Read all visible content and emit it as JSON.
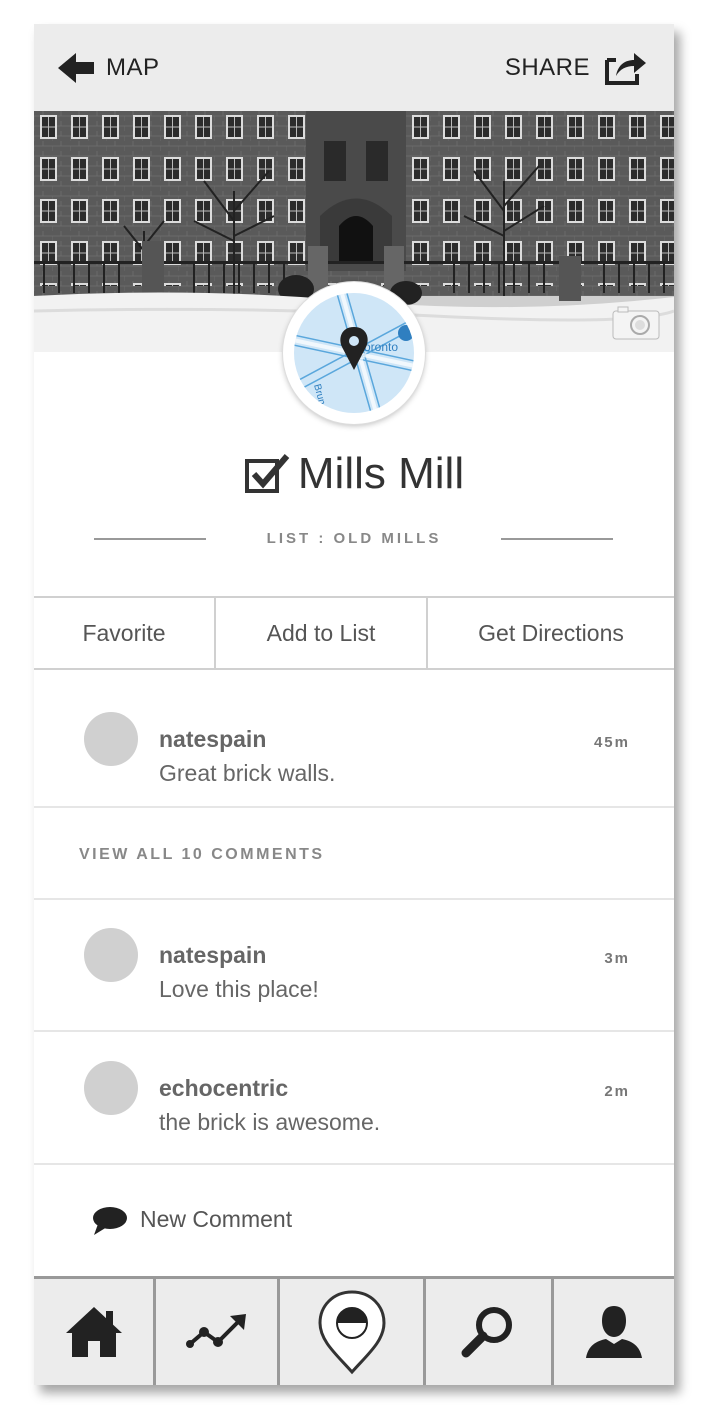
{
  "header": {
    "back_label": "MAP",
    "share_label": "SHARE"
  },
  "place": {
    "title": "Mills Mill",
    "list_label": "LIST : OLD MILLS",
    "map_street_1": "Toronto",
    "map_street_2": "Brunel"
  },
  "actions": [
    {
      "label": "Favorite"
    },
    {
      "label": "Add to List"
    },
    {
      "label": "Get Directions"
    }
  ],
  "comments": {
    "first": {
      "user": "natespain",
      "text": "Great brick walls.",
      "time": "45m"
    },
    "view_all": "VIEW ALL 10 COMMENTS",
    "rest": [
      {
        "user": "natespain",
        "text": "Love this place!",
        "time": "3m"
      },
      {
        "user": "echocentric",
        "text": "the brick is awesome.",
        "time": "2m"
      }
    ],
    "new_comment_label": "New Comment"
  },
  "tabs": [
    {
      "icon": "home-icon"
    },
    {
      "icon": "trending-icon"
    },
    {
      "icon": "place-pin-icon"
    },
    {
      "icon": "search-icon"
    },
    {
      "icon": "profile-icon"
    }
  ],
  "colors": {
    "topbar": "#ececec",
    "tabbar": "#ececec",
    "avatar": "#d0d0d0",
    "map_water": "#cfe6f7",
    "map_road": "#5aa7dc"
  }
}
